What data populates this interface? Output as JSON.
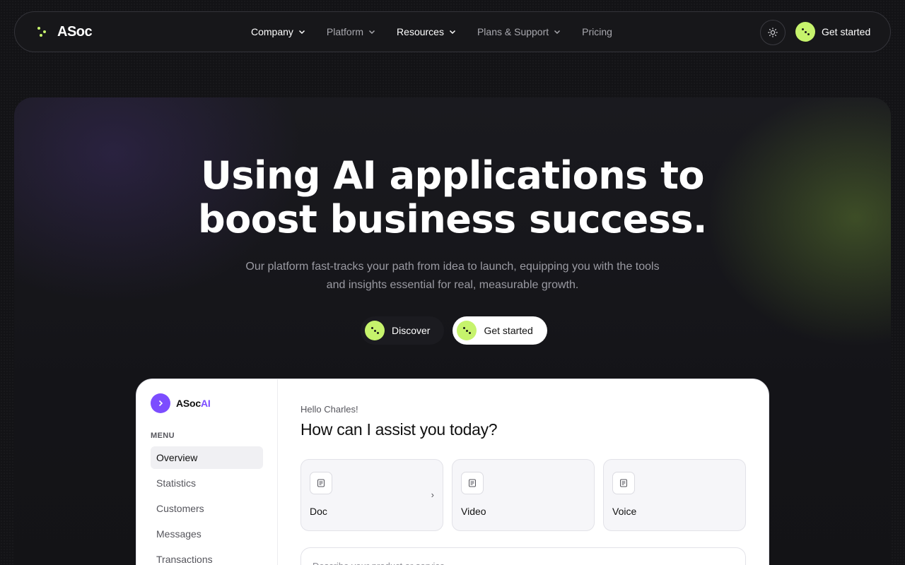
{
  "nav": {
    "logo_text": "ASoc",
    "items": [
      {
        "label": "Company",
        "has_dropdown": true
      },
      {
        "label": "Platform",
        "has_dropdown": true
      },
      {
        "label": "Resources",
        "has_dropdown": true
      },
      {
        "label": "Plans & Support",
        "has_dropdown": true
      },
      {
        "label": "Pricing",
        "has_dropdown": false
      }
    ],
    "theme_toggle_icon": "sun-icon",
    "cta_label": "Get started"
  },
  "hero": {
    "headline_line1": "Using AI applications to",
    "headline_line2": "boost business success.",
    "sub_line1": "Our platform fast-tracks your path from idea to launch, equipping you with the tools",
    "sub_line2": "and insights essential for real, measurable growth.",
    "btn_discover": "Discover",
    "btn_get_started": "Get started"
  },
  "app": {
    "brand": "ASoc",
    "brand_accent": "AI",
    "menu_label": "MENU",
    "side_items": [
      "Overview",
      "Statistics",
      "Customers",
      "Messages",
      "Transactions"
    ],
    "active_item": "Overview",
    "greeting": "Hello Charles!",
    "title": "How can I assist you today?",
    "cards": [
      {
        "label": "Doc",
        "icon": "document-icon"
      },
      {
        "label": "Video",
        "icon": "document-icon"
      },
      {
        "label": "Voice",
        "icon": "document-icon"
      }
    ],
    "card_arrow": "›",
    "prompt_placeholder": "Describe your product or service"
  },
  "colors": {
    "accent_lime": "#c6f36c",
    "accent_purple": "#7c4dff",
    "background": "#131316"
  }
}
